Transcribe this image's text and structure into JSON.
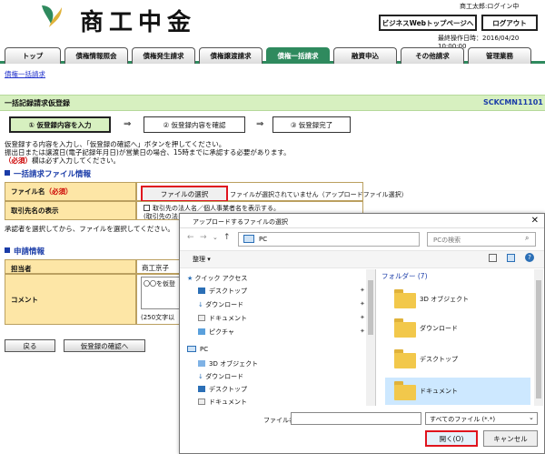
{
  "header": {
    "logo_text": "商工中金",
    "user_status": "商工太郎:ログイン中",
    "biz_web_label": "ビジネスWebトップページへ",
    "logout_label": "ログアウト",
    "last_operation": "最終操作日時：2016/04/20 10:00:00"
  },
  "tabs": [
    "トップ",
    "債権情報照会",
    "債権発生請求",
    "債権譲渡請求",
    "債権一括請求",
    "融資申込",
    "その他請求",
    "管理業務"
  ],
  "subnav": "債権一括請求",
  "page": {
    "title": "一括記録請求仮登録",
    "code": "SCKCMN11101"
  },
  "steps": [
    "① 仮登録内容を入力",
    "② 仮登録内容を確認",
    "③ 仮登録完了"
  ],
  "arrow": "⇒",
  "instructions": [
    "仮登録する内容を入力し、「仮登録の確認へ」ボタンを押してください。",
    "振出日または譲渡日(電子記録年月日)が営業日の場合、15時までに承認する必要があります。",
    "（必須）",
    "欄は必ず入力してください。"
  ],
  "file_section": {
    "title": "一括請求ファイル情報",
    "file_label": "ファイル名",
    "required_mark": "（必須）",
    "file_button": "ファイルの選択",
    "no_file_text": "ファイルが選択されていません（アップロードファイル選択）",
    "partner_label": "取引先名の表示",
    "partner_check_text": "取引先の法人名／個人事業者名を表示する。",
    "partner_note": "(取引先の法",
    "after_note": "承認者を選択してから、ファイルを選択してください。"
  },
  "apply_section": {
    "title": "申請情報",
    "person_label": "担当者",
    "person_value": "商工京子",
    "comment_label": "コメント",
    "comment_value": "〇〇を仮登",
    "comment_limit": "(250文字以"
  },
  "buttons": {
    "back": "戻る",
    "confirm": "仮登録の確認へ"
  },
  "dialog": {
    "title": "アップロードするファイルの選択",
    "close": "✕",
    "address": "PC",
    "search_placeholder": "PCの検索",
    "organize": "整理 ▾",
    "nav_items": [
      "クイック アクセス",
      "デスクトップ",
      "ダウンロード",
      "ドキュメント",
      "ピクチャ",
      "PC",
      "3D オブジェクト",
      "ダウンロード",
      "デスクトップ",
      "ドキュメント"
    ],
    "folder_header": "フォルダー (7)",
    "folders": [
      "3D オブジェクト",
      "ダウンロード",
      "デスクトップ",
      "ドキュメント"
    ],
    "filename_label": "ファイル名(N):",
    "file_type": "すべてのファイル (*.*)",
    "open_label": "開く(O)",
    "cancel_label": "キャンセル"
  },
  "colors": {
    "accent_green": "#2f8a5e",
    "label_bg": "#fde6a6",
    "highlight_red": "#e0141e",
    "title_blue": "#1a3ca8"
  }
}
